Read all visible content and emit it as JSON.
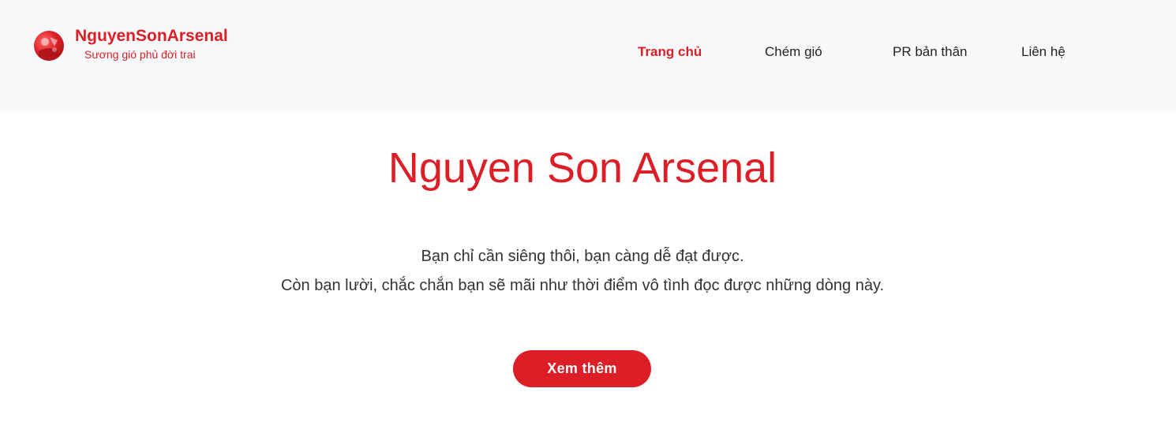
{
  "header": {
    "brand_title": "NguyenSonArsenal",
    "brand_subtitle": "Sương gió phủ đời trai",
    "logo_icon": "avatar-logo"
  },
  "nav": {
    "items": [
      {
        "label": "Trang chủ",
        "active": true
      },
      {
        "label": "Chém gió",
        "active": false
      },
      {
        "label": "PR bản thân",
        "active": false
      },
      {
        "label": "Liên hệ",
        "active": false
      }
    ]
  },
  "hero": {
    "title": "Nguyen Son Arsenal",
    "line1": "Bạn chỉ cần siêng thôi, bạn càng dễ đạt được.",
    "line2": "Còn bạn lười, chắc chắn bạn sẽ mãi như thời điểm vô tình đọc được những dòng này.",
    "button_label": "Xem thêm"
  },
  "colors": {
    "accent": "#dc1f26",
    "header_bg": "#f8f9fa",
    "text": "#333333"
  }
}
